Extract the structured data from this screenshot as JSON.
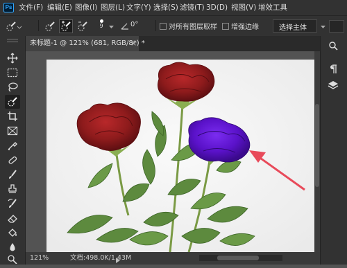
{
  "app": {
    "logo": "Ps"
  },
  "menu": [
    "文件(F)",
    "编辑(E)",
    "图像(I)",
    "图层(L)",
    "文字(Y)",
    "选择(S)",
    "滤镜(T)",
    "3D(D)",
    "视图(V)",
    "增效工具"
  ],
  "options": {
    "brush_size": "9",
    "angle": "0°",
    "sample_all_layers": "对所有图层取样",
    "enhance_edge": "增强边缘",
    "select_subject": "选择主体"
  },
  "document": {
    "tab_title": "未标题-1 @ 121% (681, RGB/8*) *",
    "zoom": "121%",
    "doc_info": "文档:498.0K/1.43M"
  },
  "colors": {
    "ui_dark": "#323232",
    "workspace": "#535353",
    "rose_red": "#8e1b1c",
    "flower_purple": "#5a12c9",
    "arrow": "#e84a5a",
    "leaf": "#5d8a3e"
  },
  "icons": [
    "quick-selection-icon",
    "move-icon",
    "marquee-icon",
    "lasso-icon",
    "crop-icon",
    "frame-icon",
    "eyedropper-icon",
    "healing-icon",
    "brush-icon",
    "stamp-icon",
    "history-brush-icon",
    "eraser-icon",
    "bucket-icon",
    "blur-icon",
    "dodge-icon",
    "search-icon",
    "paragraph-icon",
    "layers-icon"
  ]
}
